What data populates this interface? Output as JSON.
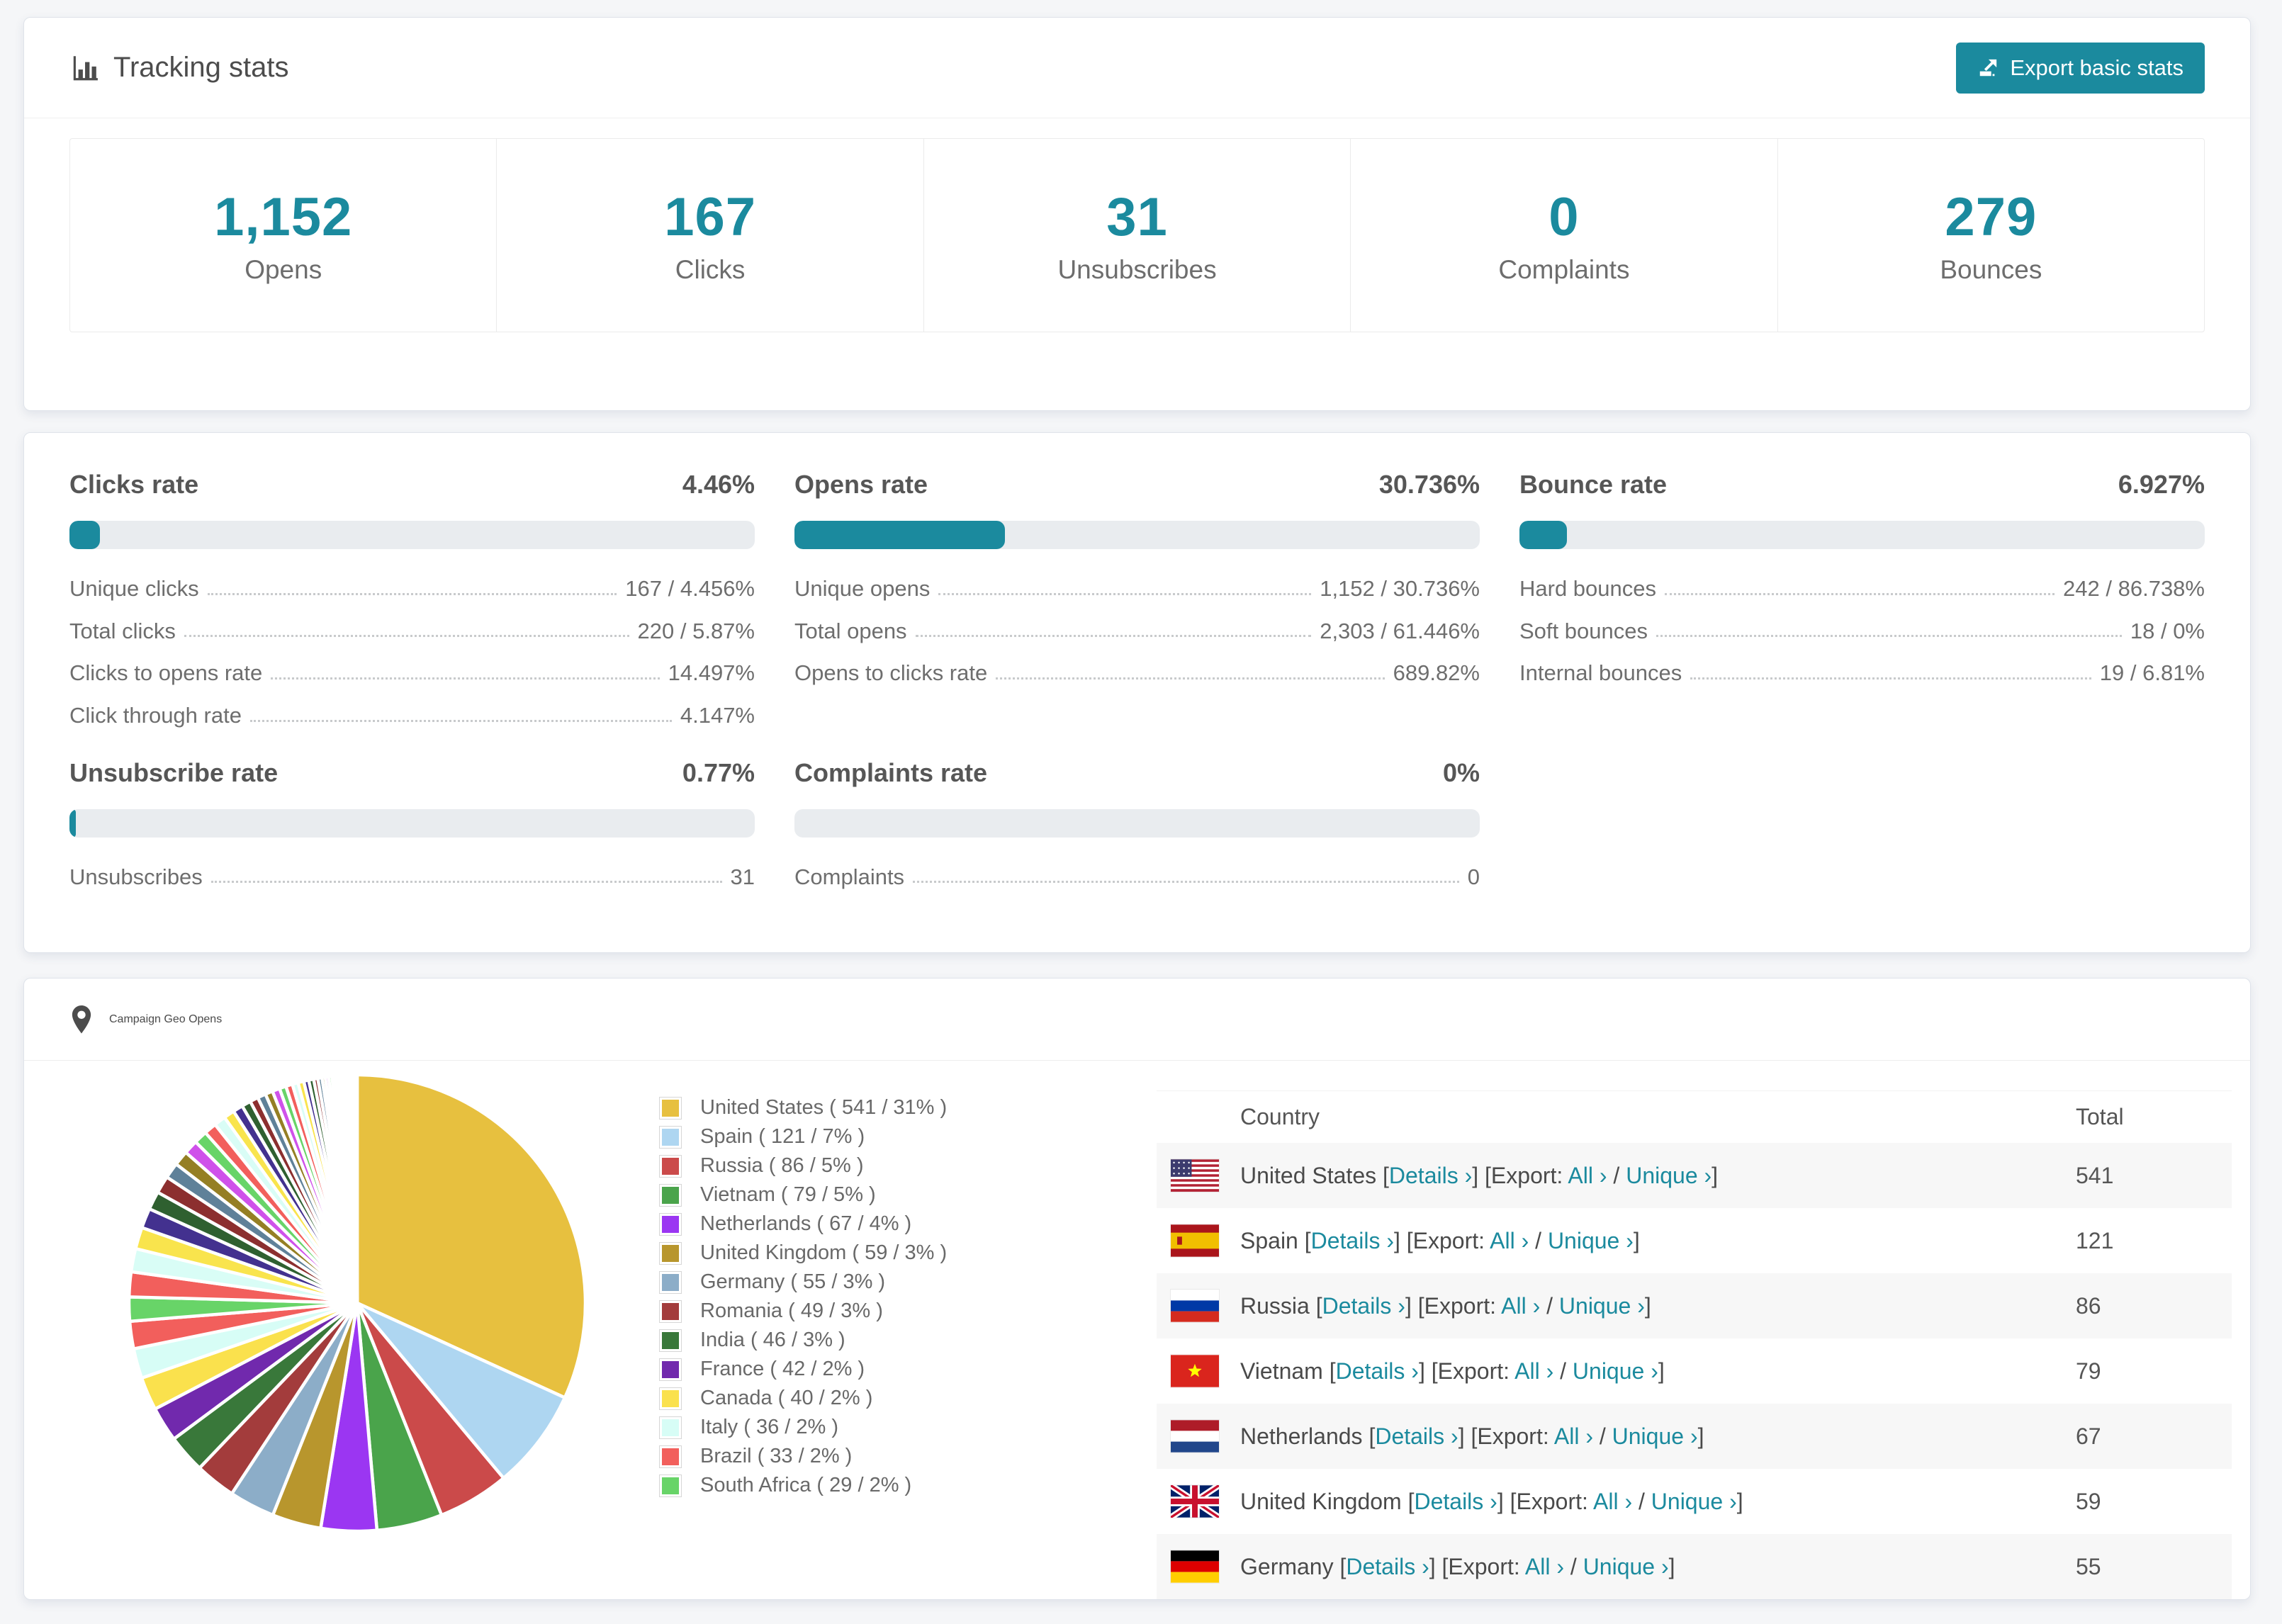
{
  "accent_color": "#1b8a9e",
  "tracking": {
    "title": "Tracking stats",
    "export_label": "Export basic stats",
    "stats": [
      {
        "value": "1,152",
        "label": "Opens"
      },
      {
        "value": "167",
        "label": "Clicks"
      },
      {
        "value": "31",
        "label": "Unsubscribes"
      },
      {
        "value": "0",
        "label": "Complaints"
      },
      {
        "value": "279",
        "label": "Bounces"
      }
    ]
  },
  "rates": {
    "blocks": [
      {
        "title": "Clicks rate",
        "value": "4.46%",
        "percent": 4.46,
        "rows": [
          {
            "label": "Unique clicks",
            "value": "167 / 4.456%"
          },
          {
            "label": "Total clicks",
            "value": "220 / 5.87%"
          },
          {
            "label": "Clicks to opens rate",
            "value": "14.497%"
          },
          {
            "label": "Click through rate",
            "value": "4.147%"
          }
        ]
      },
      {
        "title": "Opens rate",
        "value": "30.736%",
        "percent": 30.736,
        "rows": [
          {
            "label": "Unique opens",
            "value": "1,152 / 30.736%"
          },
          {
            "label": "Total opens",
            "value": "2,303 / 61.446%"
          },
          {
            "label": "Opens to clicks rate",
            "value": "689.82%"
          }
        ]
      },
      {
        "title": "Bounce rate",
        "value": "6.927%",
        "percent": 6.927,
        "rows": [
          {
            "label": "Hard bounces",
            "value": "242 / 86.738%"
          },
          {
            "label": "Soft bounces",
            "value": "18 / 0%"
          },
          {
            "label": "Internal bounces",
            "value": "19 / 6.81%"
          }
        ]
      },
      {
        "title": "Unsubscribe rate",
        "value": "0.77%",
        "percent": 0.77,
        "rows": [
          {
            "label": "Unsubscribes",
            "value": "31"
          }
        ]
      },
      {
        "title": "Complaints rate",
        "value": "0%",
        "percent": 0,
        "rows": [
          {
            "label": "Complaints",
            "value": "0"
          }
        ]
      }
    ]
  },
  "geo": {
    "title": "Campaign Geo Opens",
    "table": {
      "columns": [
        "Country",
        "Total"
      ],
      "details_label": "Details ›",
      "export_label": "Export:",
      "all_label": "All ›",
      "unique_label": "Unique ›",
      "open_bracket": "[",
      "close_bracket": "]",
      "separator": "/",
      "rows": [
        {
          "country": "United States",
          "flag": "us",
          "total": "541"
        },
        {
          "country": "Spain",
          "flag": "es",
          "total": "121"
        },
        {
          "country": "Russia",
          "flag": "ru",
          "total": "86"
        },
        {
          "country": "Vietnam",
          "flag": "vn",
          "total": "79"
        },
        {
          "country": "Netherlands",
          "flag": "nl",
          "total": "67"
        },
        {
          "country": "United Kingdom",
          "flag": "gb",
          "total": "59"
        },
        {
          "country": "Germany",
          "flag": "de",
          "total": "55"
        }
      ]
    }
  },
  "chart_data": {
    "type": "pie",
    "title": "Campaign Geo Opens",
    "legend_position": "right",
    "start_angle": "top",
    "direction": "clockwise",
    "series": [
      {
        "label": "United States",
        "value": 541,
        "percent": 31,
        "color": "#e7c03f",
        "legend": "United States ( 541 / 31% )"
      },
      {
        "label": "Spain",
        "value": 121,
        "percent": 7,
        "color": "#aed6f1",
        "legend": "Spain ( 121 / 7% )"
      },
      {
        "label": "Russia",
        "value": 86,
        "percent": 5,
        "color": "#cb4a4a",
        "legend": "Russia ( 86 / 5% )"
      },
      {
        "label": "Vietnam",
        "value": 79,
        "percent": 5,
        "color": "#4aa44b",
        "legend": "Vietnam ( 79 / 5% )"
      },
      {
        "label": "Netherlands",
        "value": 67,
        "percent": 4,
        "color": "#9b36f2",
        "legend": "Netherlands ( 67 / 4% )"
      },
      {
        "label": "United Kingdom",
        "value": 59,
        "percent": 3,
        "color": "#b8962d",
        "legend": "United Kingdom ( 59 / 3% )"
      },
      {
        "label": "Germany",
        "value": 55,
        "percent": 3,
        "color": "#8cadc8",
        "legend": "Germany ( 55 / 3% )"
      },
      {
        "label": "Romania",
        "value": 49,
        "percent": 3,
        "color": "#a33c3c",
        "legend": "Romania ( 49 / 3% )"
      },
      {
        "label": "India",
        "value": 46,
        "percent": 3,
        "color": "#39783a",
        "legend": "India ( 46 / 3% )"
      },
      {
        "label": "France",
        "value": 42,
        "percent": 2,
        "color": "#7129ad",
        "legend": "France ( 42 / 2% )"
      },
      {
        "label": "Canada",
        "value": 40,
        "percent": 2,
        "color": "#fae14d",
        "legend": "Canada ( 40 / 2% )"
      },
      {
        "label": "Italy",
        "value": 36,
        "percent": 2,
        "color": "#d7fdf6",
        "legend": "Italy ( 36 / 2% )"
      },
      {
        "label": "Brazil",
        "value": 33,
        "percent": 2,
        "color": "#f25f5c",
        "legend": "Brazil ( 33 / 2% )"
      },
      {
        "label": "South Africa",
        "value": 29,
        "percent": 2,
        "color": "#68d468",
        "legend": "South Africa ( 29 / 2% )"
      }
    ],
    "others_values": [
      30,
      28,
      26,
      24,
      22,
      21,
      19,
      18,
      17,
      16,
      15,
      14,
      13,
      12,
      11,
      10,
      10,
      9,
      9,
      8,
      8,
      7,
      7,
      6,
      6,
      5,
      5,
      4,
      4,
      4,
      3,
      3,
      3,
      2,
      2,
      2,
      2,
      1,
      1,
      1,
      1,
      1,
      1,
      1,
      1,
      1,
      1,
      1,
      1,
      1
    ],
    "tail_palette": [
      "#f25f5c",
      "#d9fdf6",
      "#f9e44d",
      "#43318f",
      "#2f6030",
      "#8c2f2f",
      "#5f8199",
      "#957f24",
      "#cf52ea",
      "#68d468"
    ]
  }
}
